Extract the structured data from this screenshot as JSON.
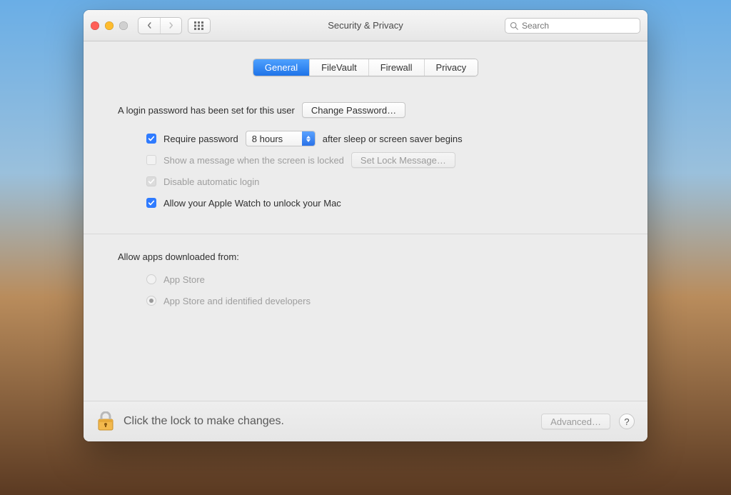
{
  "window": {
    "title": "Security & Privacy"
  },
  "search": {
    "placeholder": "Search"
  },
  "tabs": [
    {
      "label": "General",
      "active": true
    },
    {
      "label": "FileVault",
      "active": false
    },
    {
      "label": "Firewall",
      "active": false
    },
    {
      "label": "Privacy",
      "active": false
    }
  ],
  "login": {
    "password_set_text": "A login password has been set for this user",
    "change_password_label": "Change Password…",
    "require_password_label": "Require password",
    "require_password_checked": true,
    "delay_selected": "8 hours",
    "after_sleep_text": "after sleep or screen saver begins",
    "show_message_label": "Show a message when the screen is locked",
    "show_message_checked": false,
    "show_message_disabled": true,
    "set_lock_message_label": "Set Lock Message…",
    "disable_auto_login_label": "Disable automatic login",
    "disable_auto_login_checked": true,
    "disable_auto_login_disabled": true,
    "apple_watch_label": "Allow your Apple Watch to unlock your Mac",
    "apple_watch_checked": true
  },
  "gatekeeper": {
    "heading": "Allow apps downloaded from:",
    "options": [
      {
        "label": "App Store",
        "selected": false
      },
      {
        "label": "App Store and identified developers",
        "selected": true
      }
    ],
    "disabled": true
  },
  "footer": {
    "lock_text": "Click the lock to make changes.",
    "advanced_label": "Advanced…"
  }
}
